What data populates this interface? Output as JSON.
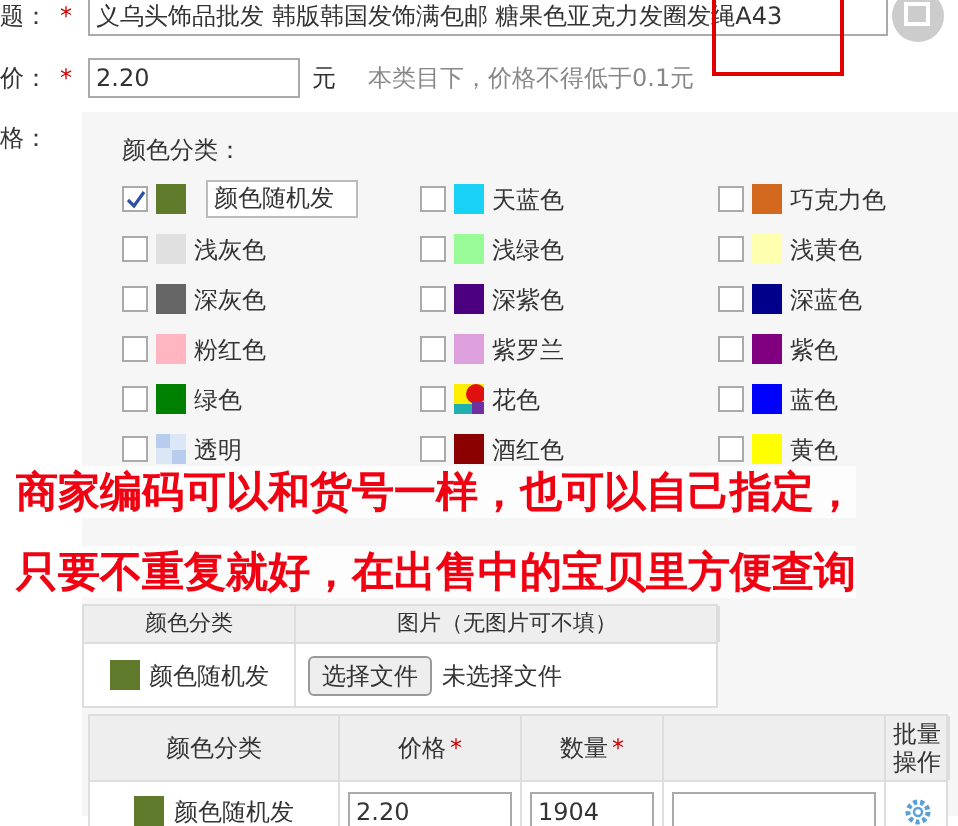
{
  "form": {
    "title_label": "题：",
    "title_value": "义乌头饰品批发 韩版韩国发饰满包邮 糖果色亚克力发圈发绳A43",
    "price_label": "价：",
    "price_value": "2.20",
    "price_unit": "元",
    "price_hint": "本类目下，价格不得低于0.1元",
    "spec_label": "格：",
    "required_mark": "*"
  },
  "colors": {
    "heading": "颜色分类：",
    "items": [
      {
        "label": "颜色随机发",
        "kind": "input",
        "color": "#5f7a2b",
        "checked": true
      },
      {
        "label": "天蓝色",
        "kind": "swatch",
        "color": "#1ad2f5",
        "checked": false
      },
      {
        "label": "巧克力色",
        "kind": "swatch",
        "color": "#d2691e",
        "checked": false
      },
      {
        "label": "浅灰色",
        "kind": "swatch",
        "color": "#e0e0e0",
        "checked": false
      },
      {
        "label": "浅绿色",
        "kind": "swatch",
        "color": "#98fb98",
        "checked": false
      },
      {
        "label": "浅黄色",
        "kind": "swatch",
        "color": "#ffffb0",
        "checked": false
      },
      {
        "label": "深灰色",
        "kind": "swatch",
        "color": "#666666",
        "checked": false
      },
      {
        "label": "深紫色",
        "kind": "swatch",
        "color": "#4b0082",
        "checked": false
      },
      {
        "label": "深蓝色",
        "kind": "swatch",
        "color": "#00008b",
        "checked": false
      },
      {
        "label": "粉红色",
        "kind": "swatch",
        "color": "#ffb6c1",
        "checked": false
      },
      {
        "label": "紫罗兰",
        "kind": "swatch",
        "color": "#dda0dd",
        "checked": false
      },
      {
        "label": "紫色",
        "kind": "swatch",
        "color": "#800080",
        "checked": false
      },
      {
        "label": "绿色",
        "kind": "swatch",
        "color": "#008000",
        "checked": false
      },
      {
        "label": "花色",
        "kind": "multicolor",
        "checked": false
      },
      {
        "label": "蓝色",
        "kind": "swatch",
        "color": "#0000ff",
        "checked": false
      },
      {
        "label": "透明",
        "kind": "transparent",
        "checked": false
      },
      {
        "label": "酒红色",
        "kind": "swatch",
        "color": "#8b0000",
        "checked": false
      },
      {
        "label": "黄色",
        "kind": "swatch",
        "color": "#ffff00",
        "checked": false
      }
    ]
  },
  "annotation": [
    "商家编码可以和货号一样，也可以自己指定，",
    "只要不重复就好，在出售中的宝贝里方便查询"
  ],
  "image_table": {
    "columns": [
      "颜色分类",
      "图片（无图片可不填）"
    ],
    "rows": [
      {
        "color": "#5f7a2b",
        "name": "颜色随机发",
        "button": "选择文件",
        "file": "未选择文件"
      }
    ]
  },
  "sku_table": {
    "columns": [
      {
        "label": "颜色分类"
      },
      {
        "label": "价格",
        "mark": "*"
      },
      {
        "label": "数量",
        "mark": "*"
      },
      {
        "label": "批量操作"
      }
    ],
    "rows": [
      {
        "color": "#5f7a2b",
        "name": "颜色随机发",
        "price": "2.20",
        "quantity": "1904"
      }
    ]
  }
}
